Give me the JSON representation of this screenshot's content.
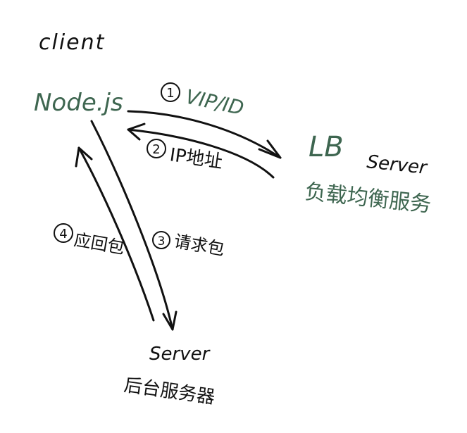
{
  "colors": {
    "ink": "#111111",
    "green": "#3e6650"
  },
  "labels": {
    "client": "client",
    "nodejs": "Node.js",
    "lb": "LB",
    "lb_server": "Server",
    "lb_cn": "负载均衡服务",
    "backend_server": "Server",
    "backend_cn": "后台服务器"
  },
  "steps": [
    {
      "num": "1",
      "text": "VIP/ID"
    },
    {
      "num": "2",
      "text": "IP地址"
    },
    {
      "num": "3",
      "text": "请求包"
    },
    {
      "num": "4",
      "text": "应回包"
    }
  ]
}
